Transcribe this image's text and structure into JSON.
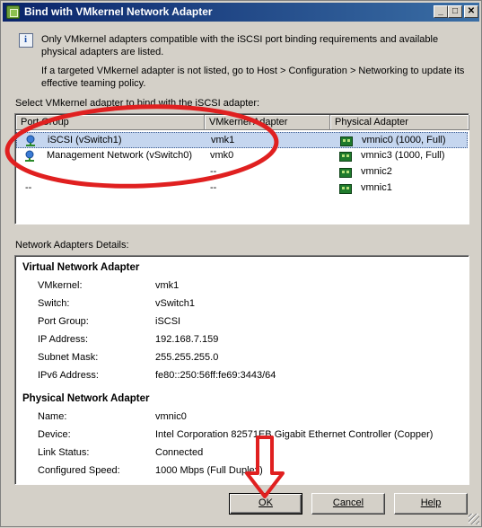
{
  "window": {
    "title": "Bind with VMkernel Network Adapter",
    "controls": {
      "minimize": "_",
      "maximize": "□",
      "close": "✕"
    }
  },
  "info": {
    "icon": "info-icon",
    "line1": "Only VMkernel adapters compatible with the iSCSI port binding requirements and available physical adapters are listed.",
    "line2": "If a targeted VMkernel adapter is not listed, go to Host > Configuration > Networking to update its effective teaming policy."
  },
  "adapter_list": {
    "label": "Select VMkernel adapter to bind with the iSCSI adapter:",
    "columns": [
      "Port Group",
      "VMkernel Adapter",
      "Physical Adapter"
    ],
    "rows": [
      {
        "port_group": "iSCSI (vSwitch1)",
        "vmkernel": "vmk1",
        "physical": "vmnic0 (1000, Full)",
        "selected": true,
        "pg_icon": "port-group-icon",
        "nic_icon": "nic-icon"
      },
      {
        "port_group": "Management Network (vSwitch0)",
        "vmkernel": "vmk0",
        "physical": "vmnic3 (1000, Full)",
        "selected": false,
        "pg_icon": "port-group-icon",
        "nic_icon": "nic-icon"
      },
      {
        "port_group": "--",
        "vmkernel": "--",
        "physical": "vmnic2",
        "selected": false,
        "nic_icon": "nic-icon"
      },
      {
        "port_group": "--",
        "vmkernel": "--",
        "physical": "vmnic1",
        "selected": false,
        "nic_icon": "nic-icon"
      }
    ]
  },
  "details": {
    "label": "Network Adapters Details:",
    "virtual": {
      "title": "Virtual Network Adapter",
      "fields": [
        {
          "key": "VMkernel:",
          "value": "vmk1"
        },
        {
          "key": "Switch:",
          "value": "vSwitch1"
        },
        {
          "key": "Port Group:",
          "value": "iSCSI"
        },
        {
          "key": "IP Address:",
          "value": "192.168.7.159"
        },
        {
          "key": "Subnet Mask:",
          "value": "255.255.255.0"
        },
        {
          "key": "IPv6 Address:",
          "value": "fe80::250:56ff:fe69:3443/64"
        }
      ]
    },
    "physical": {
      "title": "Physical Network Adapter",
      "fields": [
        {
          "key": "Name:",
          "value": "vmnic0"
        },
        {
          "key": "Device:",
          "value": "Intel Corporation 82571EB Gigabit Ethernet Controller (Copper)"
        },
        {
          "key": "Link Status:",
          "value": "Connected"
        },
        {
          "key": "Configured Speed:",
          "value": "1000 Mbps (Full Duplex)"
        }
      ]
    }
  },
  "buttons": {
    "ok": "OK",
    "cancel": "Cancel",
    "help": "Help"
  },
  "colors": {
    "selection": "#c5d6ef",
    "annotation": "#e02020",
    "titlebar": "#0a246a"
  }
}
